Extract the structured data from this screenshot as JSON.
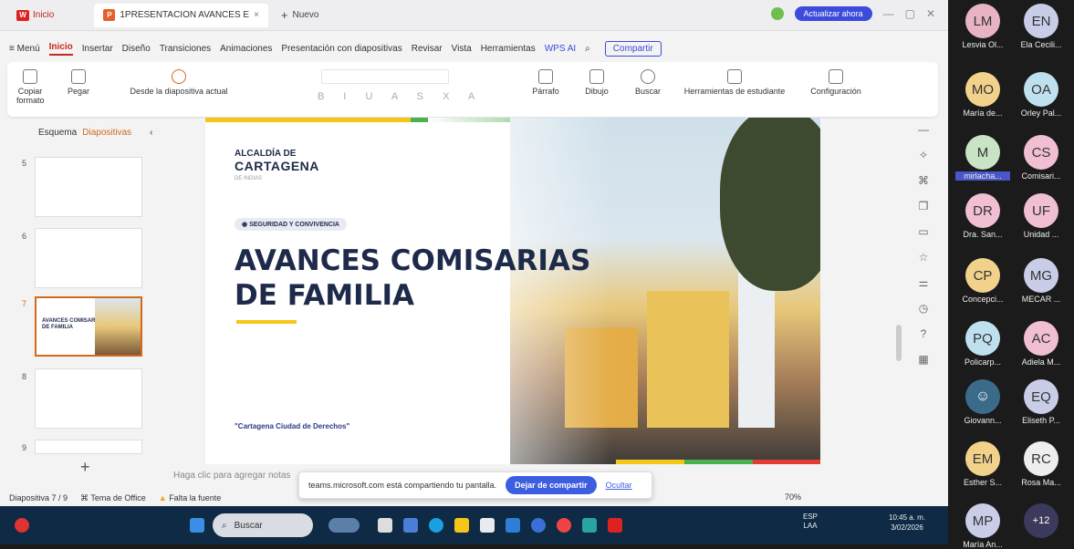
{
  "titlebar": {
    "home_tab": "Inicio",
    "doc_tab": "1PRESENTACION AVANCES E",
    "new_tab": "Nuevo",
    "update_button": "Actualizar ahora"
  },
  "menubar": {
    "menu": "Menú",
    "items": [
      "Inicio",
      "Insertar",
      "Diseño",
      "Transiciones",
      "Animaciones",
      "Presentación con diapositivas",
      "Revisar",
      "Vista",
      "Herramientas",
      "WPS AI"
    ],
    "share": "Compartir"
  },
  "ribbon": {
    "copy_format": "Copiar formato",
    "paste": "Pegar",
    "from_current": "Desde la diapositiva actual",
    "paragraph": "Párrafo",
    "drawing": "Dibujo",
    "search": "Buscar",
    "student_tools": "Herramientas de estudiante",
    "settings": "Configuración"
  },
  "sidebar": {
    "tab_outline": "Esquema",
    "tab_slides": "Diapositivas",
    "slides": [
      {
        "num": "5"
      },
      {
        "num": "6"
      },
      {
        "num": "7",
        "title": "AVANCES COMISARIAS DE FAMILIA"
      },
      {
        "num": "8"
      },
      {
        "num": "9"
      }
    ]
  },
  "slide": {
    "brand_line1": "ALCALDÍA DE",
    "brand_line2": "CARTAGENA",
    "brand_line3": "DE INDIAS",
    "pill": "SEGURIDAD Y CONVIVENCIA",
    "headline_line1": "AVANCES COMISARIAS",
    "headline_line2": "DE FAMILIA",
    "slogan": "\"Cartagena Ciudad de Derechos\"",
    "colors": {
      "navy": "#1e2a4a",
      "yellow": "#f5c518",
      "red": "#e03c31",
      "green": "#4caf50"
    }
  },
  "notes_placeholder": "Haga clic para agregar notas",
  "status": {
    "slide_counter": "Diapositiva 7 / 9",
    "theme": "Tema de Office",
    "missing_font": "Falta la fuente",
    "zoom": "70%"
  },
  "share_toast": {
    "message": "teams.microsoft.com está compartiendo tu pantalla.",
    "stop_button": "Dejar de compartir",
    "hide_link": "Ocultar"
  },
  "taskbar": {
    "search_placeholder": "Buscar",
    "lang1": "ESP",
    "lang2": "LAA",
    "time": "10:45 a. m.",
    "date": "3/02/2026"
  },
  "participants": [
    {
      "initials": "LM",
      "name": "Lesvia Ol...",
      "color": "#e8b4c4"
    },
    {
      "initials": "EN",
      "name": "Ela Cecili...",
      "color": "#c9cde8"
    },
    {
      "initials": "MO",
      "name": "María de...",
      "color": "#f2d28b"
    },
    {
      "initials": "OA",
      "name": "Orley Pal...",
      "color": "#bfe0ee"
    },
    {
      "initials": "M",
      "name": "mirlacha...",
      "color": "#c9e4c5"
    },
    {
      "initials": "CS",
      "name": "Comisari...",
      "color": "#f0bfd3"
    },
    {
      "initials": "DR",
      "name": "Dra. San...",
      "color": "#f0bfd3"
    },
    {
      "initials": "UF",
      "name": "Unidad ...",
      "color": "#f0bfd3"
    },
    {
      "initials": "CP",
      "name": "Concepci...",
      "color": "#f2d28b"
    },
    {
      "initials": "MG",
      "name": "MECAR ...",
      "color": "#c9cde8"
    },
    {
      "initials": "PQ",
      "name": "Policarp...",
      "color": "#bfe0ee"
    },
    {
      "initials": "AC",
      "name": "Adiela M...",
      "color": "#f0bfd3"
    },
    {
      "initials": "",
      "name": "Giovann...",
      "color": "#3a6c8a"
    },
    {
      "initials": "EQ",
      "name": "Eliseth P...",
      "color": "#c9cde8"
    },
    {
      "initials": "EM",
      "name": "Esther S...",
      "color": "#f2d28b"
    },
    {
      "initials": "RC",
      "name": "Rosa Ma...",
      "color": "#eee"
    },
    {
      "initials": "MP",
      "name": "María An...",
      "color": "#c9cde8"
    },
    {
      "initials": "+12",
      "name": "",
      "color": "#3b3a5c"
    }
  ]
}
